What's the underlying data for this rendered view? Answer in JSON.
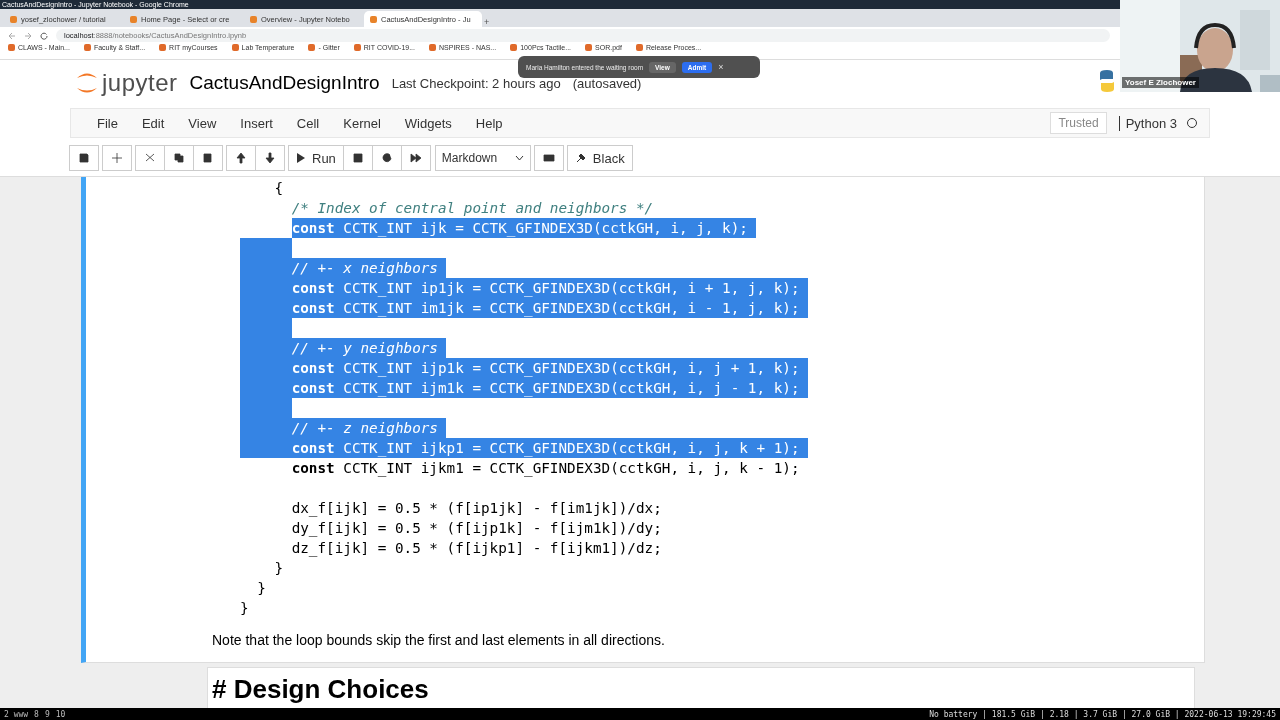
{
  "window": {
    "title": "CactusAndDesignIntro - Jupyter Notebook - Google Chrome"
  },
  "tabs": [
    {
      "label": "yosef_zlochower / tutorial",
      "selected": false
    },
    {
      "label": "Home Page - Select or cre",
      "selected": false
    },
    {
      "label": "Overview - Jupyter Notebo",
      "selected": false
    },
    {
      "label": "CactusAndDesignIntro - Ju",
      "selected": true
    }
  ],
  "new_tab": "+",
  "address": {
    "host": "localhost",
    "rest": ":8888/notebooks/CactusAndDesignIntro.ipynb"
  },
  "bookmarks": [
    "CLAWS - Main...",
    "Faculty & Staff...",
    "RIT myCourses",
    "Lab Temperature",
    "- Gitter",
    "RIT COVID-19...",
    "NSPIRES - NAS...",
    "100Pcs Tactile...",
    "SOR.pdf",
    "Release Proces..."
  ],
  "toast": {
    "message": "Maria Hamilton entered the waiting room",
    "view": "View",
    "admit": "Admit",
    "close": "×"
  },
  "video": {
    "name": "Yosef E Zlochower"
  },
  "header": {
    "logo": "jupyter",
    "title": "CactusAndDesignIntro",
    "checkpoint": "Last Checkpoint: 2 hours ago",
    "saved": "(autosaved)"
  },
  "menu": [
    "File",
    "Edit",
    "View",
    "Insert",
    "Cell",
    "Kernel",
    "Widgets",
    "Help"
  ],
  "trusted": "Trusted",
  "kernel": "Python 3",
  "toolbar": {
    "run": "Run",
    "cell_type": "Markdown",
    "black": "Black"
  },
  "code": [
    {
      "kind": "code",
      "text": "    {",
      "selected": false,
      "indent_selected": false
    },
    {
      "kind": "comment",
      "text": "      /* Index of central point and neighbors */",
      "selected": false,
      "indent_selected": false
    },
    {
      "kind": "code",
      "text": "      **const** CCTK_INT ijk = CCTK_GFINDEX3D(cctkGH, i, j, k);",
      "selected": true,
      "indent_selected": false
    },
    {
      "kind": "blank",
      "indent_selected": true
    },
    {
      "kind": "comment",
      "text": "      // +- x neighbors",
      "selected": true,
      "indent_selected": true
    },
    {
      "kind": "code",
      "text": "      **const** CCTK_INT ip1jk = CCTK_GFINDEX3D(cctkGH, i + 1, j, k);",
      "selected": true,
      "indent_selected": true
    },
    {
      "kind": "code",
      "text": "      **const** CCTK_INT im1jk = CCTK_GFINDEX3D(cctkGH, i - 1, j, k);",
      "selected": true,
      "indent_selected": true
    },
    {
      "kind": "blank",
      "indent_selected": true
    },
    {
      "kind": "comment",
      "text": "      // +- y neighbors",
      "selected": true,
      "indent_selected": true
    },
    {
      "kind": "code",
      "text": "      **const** CCTK_INT ijp1k = CCTK_GFINDEX3D(cctkGH, i, j + 1, k);",
      "selected": true,
      "indent_selected": true
    },
    {
      "kind": "code",
      "text": "      **const** CCTK_INT ijm1k = CCTK_GFINDEX3D(cctkGH, i, j - 1, k);",
      "selected": true,
      "indent_selected": true
    },
    {
      "kind": "blank",
      "indent_selected": true
    },
    {
      "kind": "comment",
      "text": "      // +- z neighbors",
      "selected": true,
      "indent_selected": true
    },
    {
      "kind": "code",
      "text": "      **const** CCTK_INT ijkp1 = CCTK_GFINDEX3D(cctkGH, i, j, k + 1);",
      "selected": true,
      "indent_selected": true
    },
    {
      "kind": "code",
      "text": "      **const** CCTK_INT ijkm1 = CCTK_GFINDEX3D(cctkGH, i, j, k - 1);",
      "selected": false,
      "indent_selected": false
    },
    {
      "kind": "blank",
      "indent_selected": false
    },
    {
      "kind": "code",
      "text": "      dx_f[ijk] = 0.5 * (f[ip1jk] - f[im1jk])/dx;",
      "selected": false,
      "indent_selected": false
    },
    {
      "kind": "code",
      "text": "      dy_f[ijk] = 0.5 * (f[ijp1k] - f[ijm1k])/dy;",
      "selected": false,
      "indent_selected": false
    },
    {
      "kind": "code",
      "text": "      dz_f[ijk] = 0.5 * (f[ijkp1] - f[ijkm1])/dz;",
      "selected": false,
      "indent_selected": false
    },
    {
      "kind": "code",
      "text": "    }",
      "selected": false,
      "indent_selected": false
    },
    {
      "kind": "code",
      "text": "  }",
      "selected": false,
      "indent_selected": false
    },
    {
      "kind": "code",
      "text": "}",
      "selected": false,
      "indent_selected": false
    }
  ],
  "note": "Note that the loop bounds skip the first and last elements in all directions.",
  "next_cell": "# Design Choices",
  "status_bar": {
    "workspaces": [
      "2 www",
      "8",
      "9",
      "10"
    ],
    "info": "No battery | 181.5 GiB | 2.18 | 3.7 GiB | 27.0 GiB | 2022-06-13 19:29:45"
  }
}
